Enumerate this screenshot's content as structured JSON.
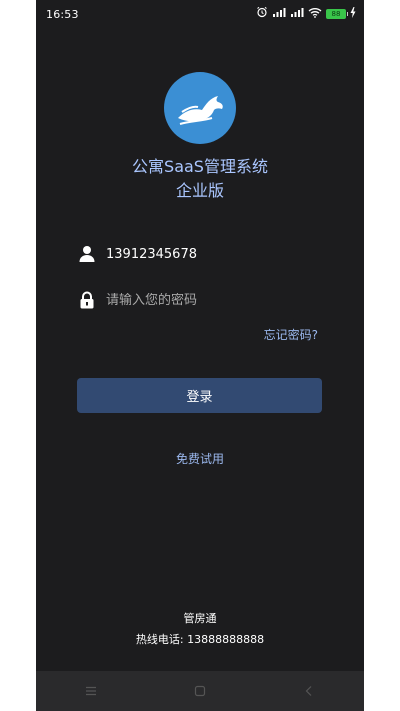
{
  "status_bar": {
    "time": "16:53",
    "battery": "88"
  },
  "app": {
    "logo": "horse-logo-icon",
    "title_line1": "公寓SaaS管理系统",
    "title_line2": "企业版"
  },
  "form": {
    "phone_value": "13912345678",
    "password_placeholder": "请输入您的密码",
    "forgot_label": "忘记密码?",
    "login_label": "登录",
    "trial_label": "免费试用"
  },
  "footer": {
    "company": "管房通",
    "hotline": "热线电话: 13888888888"
  },
  "navigation": {
    "items": [
      "menu-icon",
      "home-icon",
      "back-icon"
    ]
  },
  "colors": {
    "background": "#1c1c1e",
    "accent_text": "#aac6ff",
    "button": "#324a72",
    "logo_bg": "#3b8fd4"
  }
}
